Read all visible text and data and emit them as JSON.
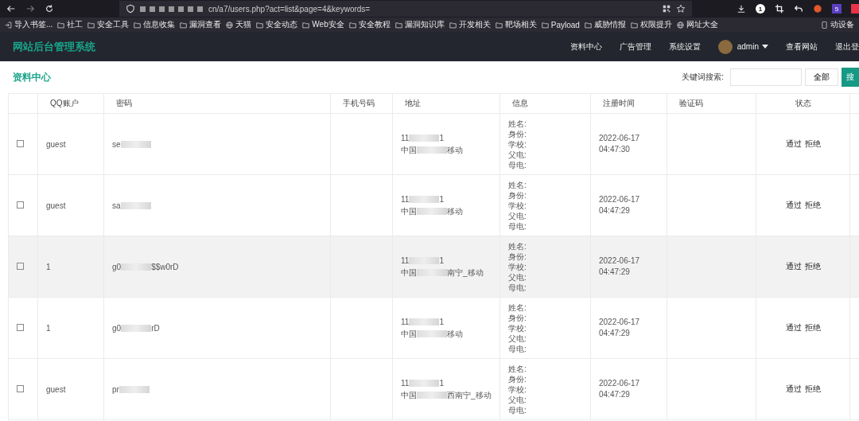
{
  "browser": {
    "url": "cn/a7/users.php?act=list&page=4&keywords=",
    "counter_badge": "1",
    "extension_badge": "5",
    "bookmarks": [
      {
        "kind": "import",
        "label": "导入书签..."
      },
      {
        "kind": "folder",
        "label": "社工"
      },
      {
        "kind": "folder",
        "label": "安全工具"
      },
      {
        "kind": "folder",
        "label": "信息收集"
      },
      {
        "kind": "folder",
        "label": "漏洞查看"
      },
      {
        "kind": "globe",
        "label": "天猫"
      },
      {
        "kind": "folder",
        "label": "安全动态"
      },
      {
        "kind": "folder",
        "label": "Web安全"
      },
      {
        "kind": "folder",
        "label": "安全教程"
      },
      {
        "kind": "folder",
        "label": "漏洞知识库"
      },
      {
        "kind": "folder",
        "label": "开发相关"
      },
      {
        "kind": "folder",
        "label": "靶场相关"
      },
      {
        "kind": "folder",
        "label": "Payload"
      },
      {
        "kind": "folder",
        "label": "威胁情报"
      },
      {
        "kind": "folder",
        "label": "权限提升"
      },
      {
        "kind": "globe",
        "label": "网址大全"
      }
    ],
    "mobile_bookmarks": "动设备"
  },
  "header": {
    "title": "网站后台管理系统",
    "nav": [
      "资料中心",
      "广告管理",
      "系统设置"
    ],
    "user": "admin",
    "links": [
      "查看网站",
      "退出登"
    ]
  },
  "page": {
    "title": "资料中心",
    "search_label": "关键词搜索:",
    "all_button": "全部",
    "search_button": "搜"
  },
  "table": {
    "columns": [
      "QQ账户",
      "密码",
      "手机号码",
      "地址",
      "信息",
      "注册时间",
      "验证码",
      "状态"
    ],
    "rows": [
      {
        "checked": false,
        "highlighted": false,
        "account": "guest",
        "password_start": "se",
        "password_end": "",
        "address": [
          {
            "start": "11",
            "end": "1"
          },
          {
            "start": "中国",
            "end": "移动"
          }
        ],
        "info": [
          "姓名:",
          "身份:",
          "学校:",
          "父电:",
          "母电:"
        ],
        "date": "2022-06-17",
        "time": "04:47:30",
        "actions": [
          "通过",
          "拒绝"
        ]
      },
      {
        "checked": false,
        "highlighted": false,
        "account": "guest",
        "password_start": "sa",
        "password_end": "",
        "address": [
          {
            "start": "11",
            "end": "1"
          },
          {
            "start": "中国",
            "end": "移动"
          }
        ],
        "info": [
          "姓名:",
          "身份:",
          "学校:",
          "父电:",
          "母电:"
        ],
        "date": "2022-06-17",
        "time": "04:47:29",
        "actions": [
          "通过",
          "拒绝"
        ]
      },
      {
        "checked": false,
        "highlighted": true,
        "account": "1",
        "password_start": "g0",
        "password_end": "$$w0rD",
        "address": [
          {
            "start": "11",
            "end": "1"
          },
          {
            "start": "中国",
            "end": "南宁_移动"
          }
        ],
        "info": [
          "姓名:",
          "身份:",
          "学校:",
          "父电:",
          "母电:"
        ],
        "date": "2022-06-17",
        "time": "04:47:29",
        "actions": [
          "通过",
          "拒绝"
        ]
      },
      {
        "checked": false,
        "highlighted": false,
        "account": "1",
        "password_start": "g0",
        "password_end": "rD",
        "address": [
          {
            "start": "11",
            "end": "1"
          },
          {
            "start": "中国",
            "end": "移动"
          }
        ],
        "info": [
          "姓名:",
          "身份:",
          "学校:",
          "父电:",
          "母电:"
        ],
        "date": "2022-06-17",
        "time": "04:47:29",
        "actions": [
          "通过",
          "拒绝"
        ]
      },
      {
        "checked": false,
        "highlighted": false,
        "account": "guest",
        "password_start": "pr",
        "password_end": "",
        "address": [
          {
            "start": "11",
            "end": "1"
          },
          {
            "start": "中国",
            "end": "西南宁_移动"
          }
        ],
        "info": [
          "姓名:",
          "身份:",
          "学校:",
          "父电:",
          "母电:"
        ],
        "date": "2022-06-17",
        "time": "04:47:29",
        "actions": [
          "通过",
          "拒绝"
        ]
      }
    ]
  }
}
